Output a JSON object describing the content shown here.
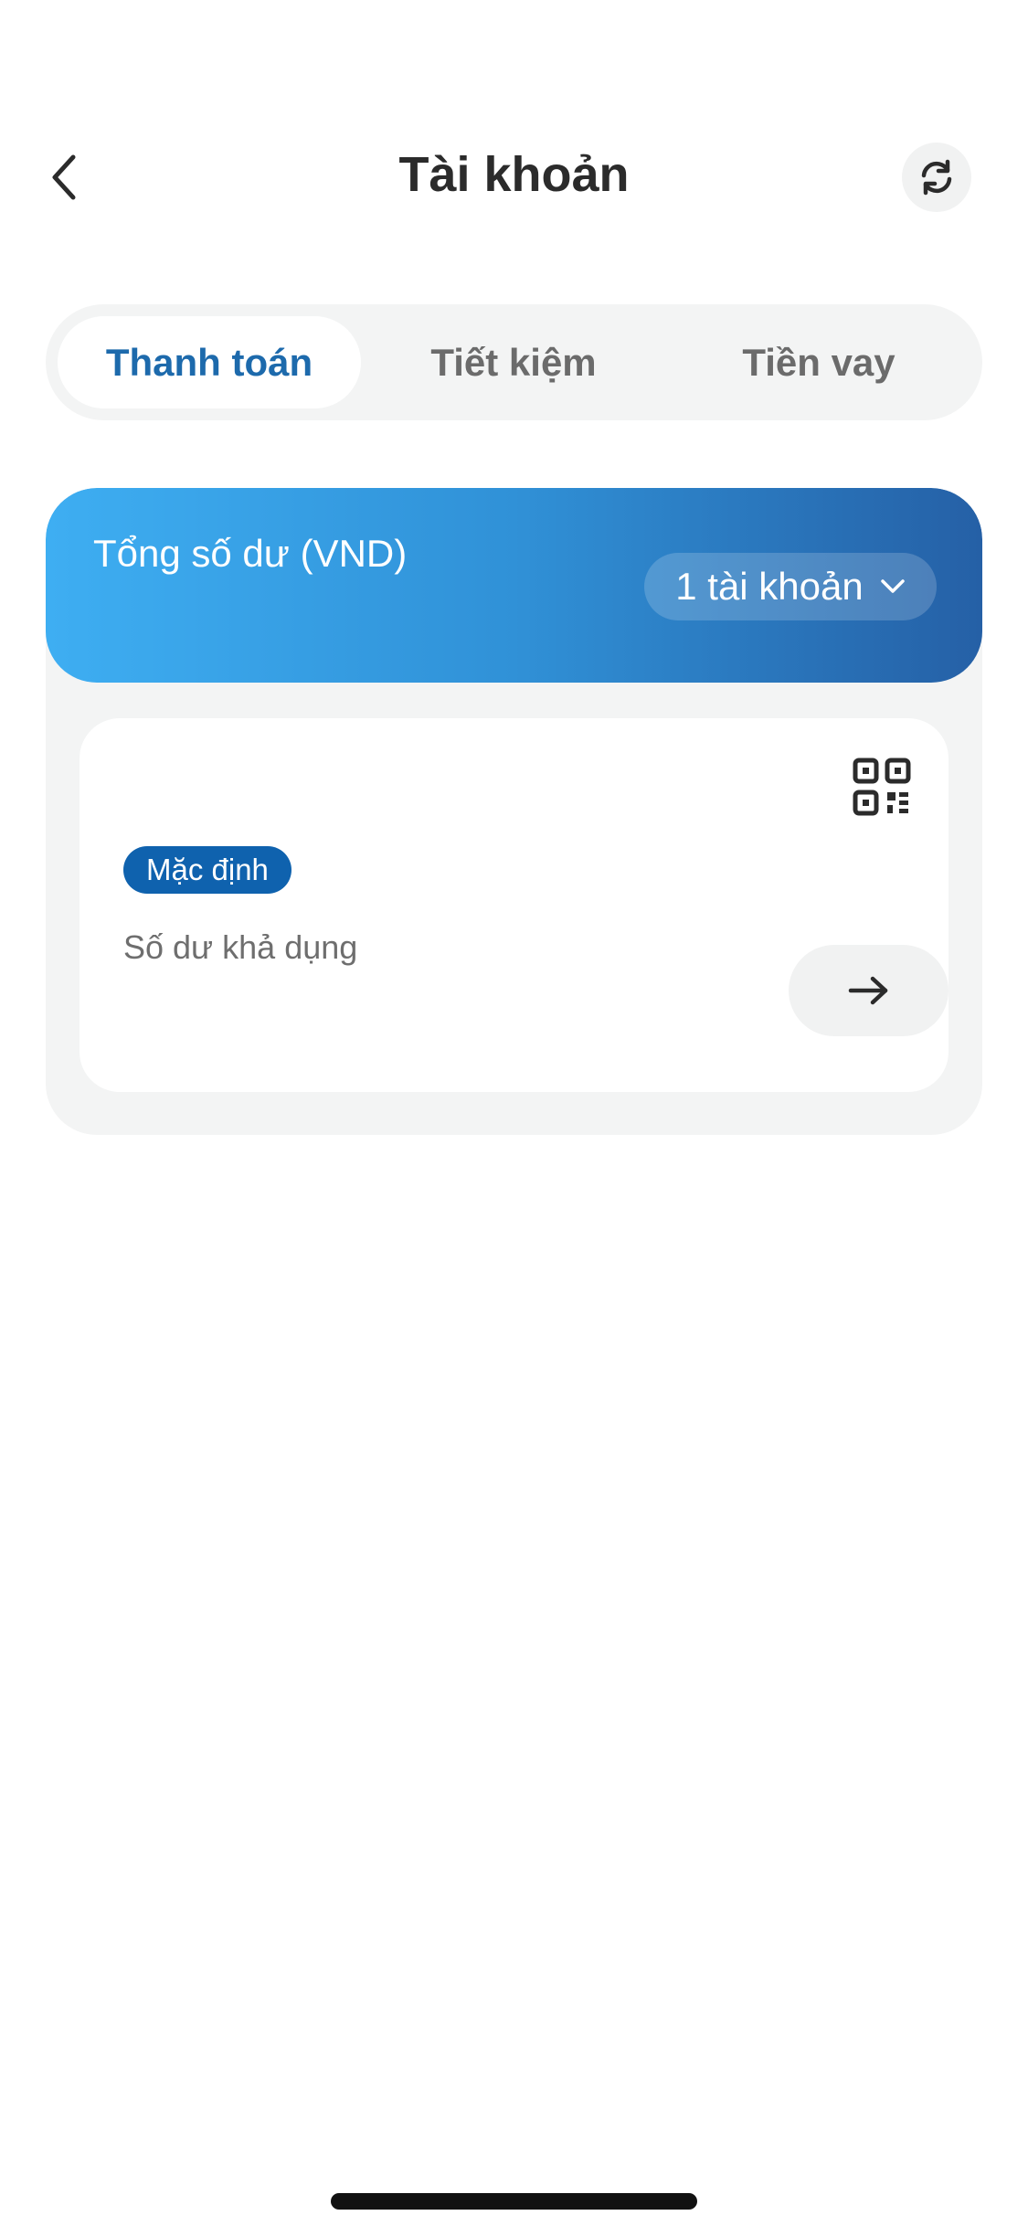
{
  "header": {
    "title": "Tài khoản",
    "back_icon": "chevron-left-icon",
    "refresh_icon": "refresh-icon"
  },
  "tabs": [
    {
      "label": "Thanh toán",
      "active": true
    },
    {
      "label": "Tiết kiệm",
      "active": false
    },
    {
      "label": "Tiền vay",
      "active": false
    }
  ],
  "balance": {
    "label": "Tổng số dư (VND)",
    "accounts_selector": "1 tài khoản",
    "selector_icon": "chevron-down-icon"
  },
  "account_card": {
    "badge": "Mặc định",
    "available_label": "Số dư khả dụng",
    "qr_icon": "qr-code-icon",
    "action_icon": "arrow-right-icon"
  },
  "colors": {
    "accent": "#1d6aac",
    "badge": "#0f62ae",
    "gradient_start": "#3eaef2",
    "gradient_end": "#2560a6",
    "surface": "#f3f4f4"
  }
}
